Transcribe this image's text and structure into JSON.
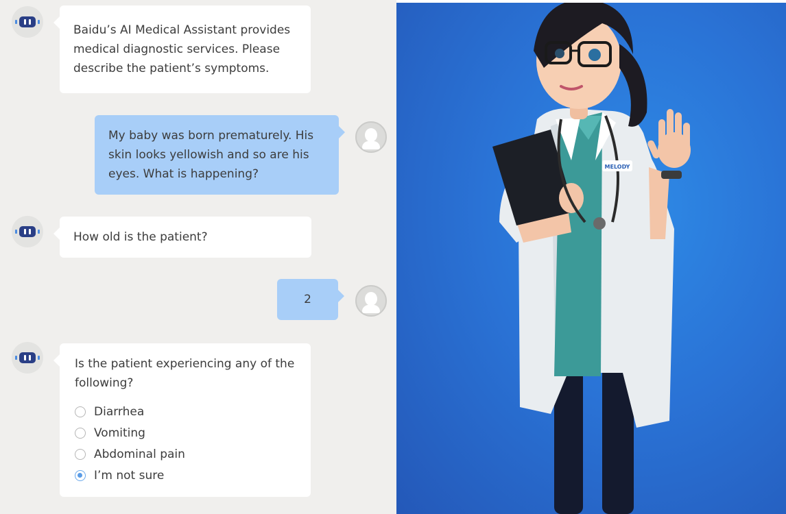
{
  "chat": {
    "messages": [
      {
        "sender": "assistant",
        "text": "Baidu’s AI Medical Assistant provides medical diagnostic services. Please describe the patient’s symptoms."
      },
      {
        "sender": "user",
        "text": "My baby was born prematurely. His skin looks yellowish and so are his eyes. What is happening?"
      },
      {
        "sender": "assistant",
        "text": "How old is the patient?"
      },
      {
        "sender": "user",
        "text": "2"
      },
      {
        "sender": "assistant",
        "text": "Is the patient experiencing any of the following?"
      }
    ],
    "options": [
      {
        "label": "Diarrhea",
        "selected": false
      },
      {
        "label": "Vomiting",
        "selected": false
      },
      {
        "label": "Abdominal pain",
        "selected": false
      },
      {
        "label": "I’m not sure",
        "selected": true
      }
    ],
    "avatars": {
      "assistant_icon": "robot-icon",
      "user_icon": "user-icon"
    }
  },
  "illustration": {
    "badge_text": "MELODY",
    "background_color": "#2a73d6"
  },
  "colors": {
    "chat_background": "#f0efed",
    "assistant_bubble": "#ffffff",
    "user_bubble": "#a8cef8",
    "radio_selected": "#5b9ce6"
  }
}
